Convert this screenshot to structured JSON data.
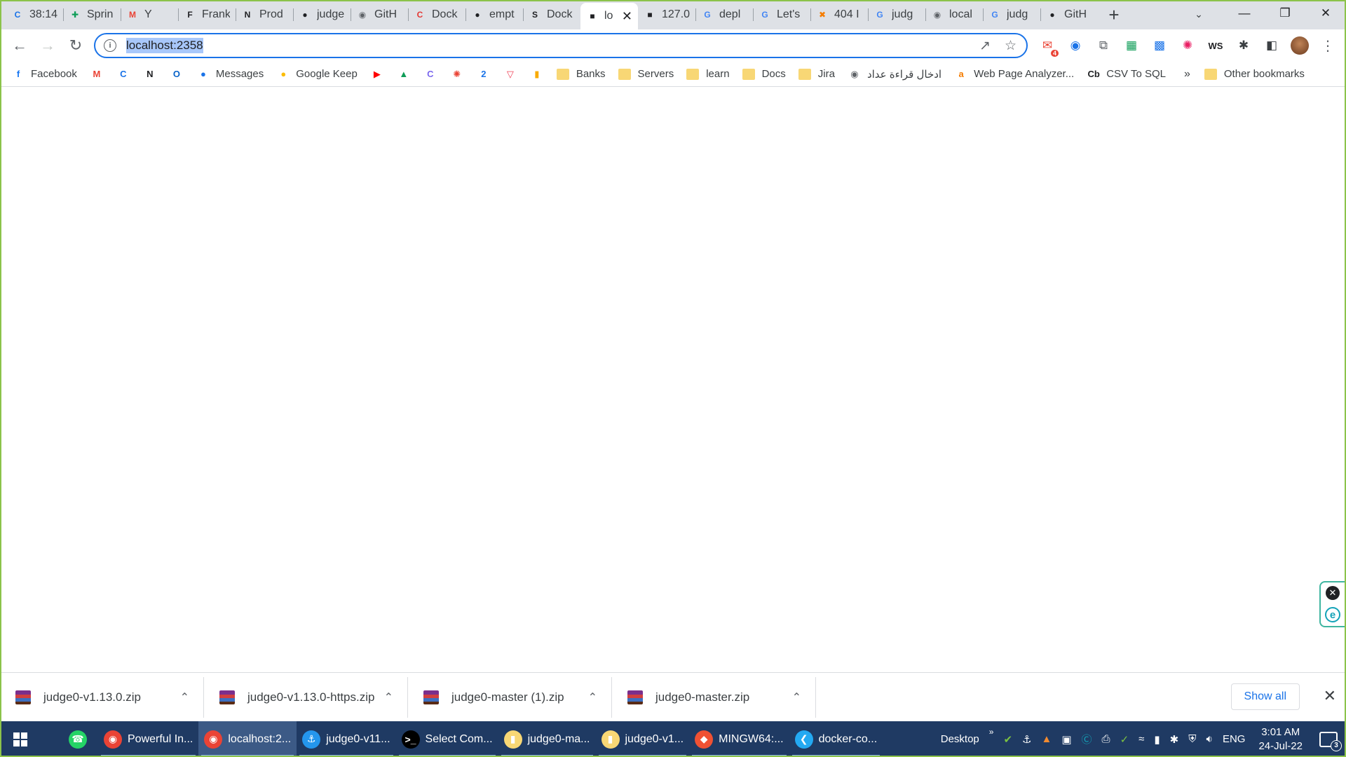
{
  "browser": {
    "tabs": [
      {
        "title": "38:14",
        "icon": "clickup-icon",
        "color": "#1a73e8"
      },
      {
        "title": "Sprin",
        "icon": "sheets-icon",
        "color": "#0f9d58"
      },
      {
        "title": "Y",
        "icon": "gmail-icon",
        "color": "#ea4335"
      },
      {
        "title": "Frank",
        "icon": "frankenstein-icon",
        "color": "#202124"
      },
      {
        "title": "Prod",
        "icon": "notion-icon",
        "color": "#202124"
      },
      {
        "title": "judge",
        "icon": "github-icon",
        "color": "#202124"
      },
      {
        "title": "GitH",
        "icon": "globe-icon",
        "color": "#5f6368"
      },
      {
        "title": "Dock",
        "icon": "docker-red-icon",
        "color": "#e53935"
      },
      {
        "title": "empt",
        "icon": "github-icon",
        "color": "#202124"
      },
      {
        "title": "Dock",
        "icon": "s-icon",
        "color": "#202124"
      },
      {
        "title": "lo",
        "icon": "judge-icon",
        "color": "#202124",
        "active": true
      },
      {
        "title": "127.0",
        "icon": "judge-icon",
        "color": "#202124"
      },
      {
        "title": "depl",
        "icon": "google-icon",
        "color": "#4285f4"
      },
      {
        "title": "Let's",
        "icon": "google-icon",
        "color": "#4285f4"
      },
      {
        "title": "404 I",
        "icon": "x-box-icon",
        "color": "#f57c00"
      },
      {
        "title": "judg",
        "icon": "google-icon",
        "color": "#4285f4"
      },
      {
        "title": "local",
        "icon": "globe-icon",
        "color": "#5f6368"
      },
      {
        "title": "judg",
        "icon": "google-icon",
        "color": "#4285f4"
      },
      {
        "title": "GitH",
        "icon": "github-icon",
        "color": "#202124"
      }
    ],
    "url": "localhost:2358",
    "bookmarks": [
      {
        "label": "Facebook",
        "icon": "facebook-icon",
        "color": "#1877f2"
      },
      {
        "label": "",
        "icon": "gmail-icon",
        "color": "#ea4335"
      },
      {
        "label": "",
        "icon": "clickup-icon",
        "color": "#1a73e8"
      },
      {
        "label": "",
        "icon": "notion-icon",
        "color": "#202124"
      },
      {
        "label": "",
        "icon": "outlook-icon",
        "color": "#0a64c9"
      },
      {
        "label": "Messages",
        "icon": "messages-icon",
        "color": "#1a73e8"
      },
      {
        "label": "Google Keep",
        "icon": "keep-icon",
        "color": "#fbbc04"
      },
      {
        "label": "",
        "icon": "youtube-icon",
        "color": "#ff0000"
      },
      {
        "label": "",
        "icon": "drive-icon",
        "color": "#0f9d58"
      },
      {
        "label": "",
        "icon": "clickup-icon",
        "color": "#7b68ee"
      },
      {
        "label": "",
        "icon": "photos-icon",
        "color": "#ea4335"
      },
      {
        "label": "",
        "icon": "calendar-icon",
        "color": "#1a73e8"
      },
      {
        "label": "",
        "icon": "pocket-icon",
        "color": "#ef4056"
      },
      {
        "label": "",
        "icon": "analytics-icon",
        "color": "#f9ab00"
      }
    ],
    "bookmark_folders": [
      "Banks",
      "Servers",
      "learn",
      "Docs",
      "Jira"
    ],
    "bookmarks_tail": [
      {
        "label": "ادخال قراءة عداد",
        "icon": "globe-icon",
        "color": "#5f6368"
      },
      {
        "label": "Web Page Analyzer...",
        "icon": "a-icon",
        "color": "#f57c00"
      },
      {
        "label": "CSV To SQL",
        "icon": "cb-icon",
        "color": "#202124"
      }
    ],
    "bookmarks_more": "»",
    "other_bookmarks": "Other bookmarks",
    "mail_badge": "4",
    "ext_ws": "WS"
  },
  "downloads": {
    "items": [
      {
        "name": "judge0-v1.13.0.zip"
      },
      {
        "name": "judge0-v1.13.0-https.zip"
      },
      {
        "name": "judge0-master (1).zip"
      },
      {
        "name": "judge0-master.zip"
      }
    ],
    "show_all": "Show all"
  },
  "taskbar": {
    "apps": [
      {
        "label": "",
        "icon": "whatsapp-icon",
        "color": "#25d366"
      },
      {
        "label": "Powerful In...",
        "icon": "chrome-icon",
        "color": "#ea4335",
        "running": true
      },
      {
        "label": "localhost:2...",
        "icon": "chrome-icon",
        "color": "#ea4335",
        "running": true,
        "active": true
      },
      {
        "label": "judge0-v11...",
        "icon": "docker-icon",
        "color": "#2496ed",
        "running": true
      },
      {
        "label": "Select Com...",
        "icon": "terminal-icon",
        "color": "#000000",
        "running": true
      },
      {
        "label": "judge0-ma...",
        "icon": "folder-icon",
        "color": "#f8d775",
        "running": true
      },
      {
        "label": "judge0-v1...",
        "icon": "folder-icon",
        "color": "#f8d775",
        "running": true
      },
      {
        "label": "MINGW64:...",
        "icon": "git-icon",
        "color": "#f05133",
        "running": true
      },
      {
        "label": "docker-co...",
        "icon": "vscode-icon",
        "color": "#23a9f2",
        "running": true
      }
    ],
    "desktop_label": "Desktop",
    "language": "ENG",
    "time": "3:01 AM",
    "date": "24-Jul-22",
    "notification_count": "3"
  }
}
